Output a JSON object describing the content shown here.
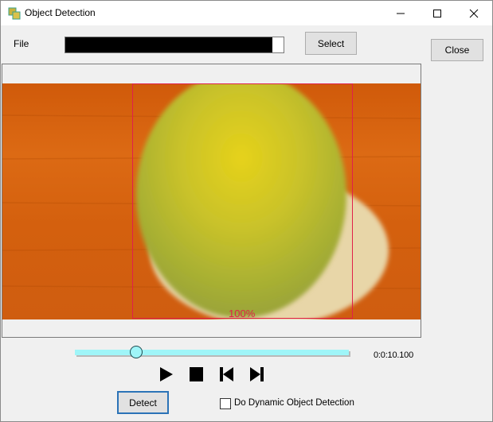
{
  "window": {
    "title": "Object Detection",
    "icon": "app-icon",
    "controls": [
      "minimize-icon",
      "maximize-icon",
      "close-icon"
    ]
  },
  "file": {
    "label": "File",
    "path_bar_progress": 0.95,
    "select_label": "Select"
  },
  "close_label": "Close",
  "video": {
    "detection": {
      "confidence_label": "100%",
      "box_color": "#e0204a"
    }
  },
  "playback": {
    "position_fraction": 0.225,
    "time": "0:0:10.100",
    "controls": [
      "play-icon",
      "stop-icon",
      "skip-back-icon",
      "skip-forward-icon"
    ]
  },
  "detect_label": "Detect",
  "dynamic_detection": {
    "label": "Do Dynamic Object Detection",
    "checked": false
  },
  "colors": {
    "slider": "#9ff5f8",
    "accent": "#2b73b7"
  }
}
